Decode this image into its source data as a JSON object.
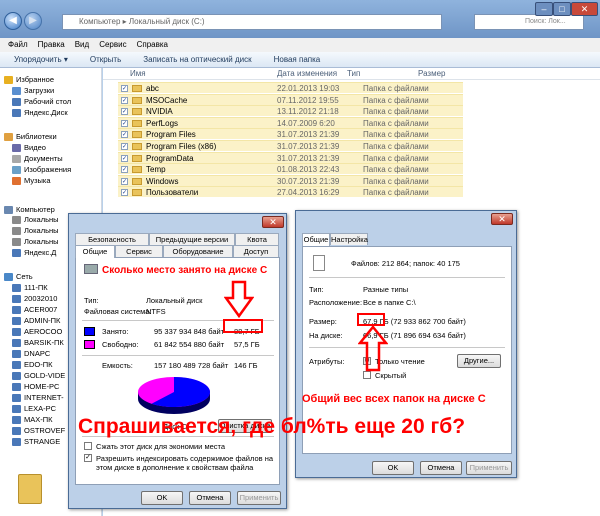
{
  "explorer": {
    "address": "Компьютер ▸ Локальный диск (C:)",
    "search_placeholder": "Поиск: Лок...",
    "menu": [
      "Файл",
      "Правка",
      "Вид",
      "Сервис",
      "Справка"
    ],
    "toolbar": [
      "Упорядочить ▾",
      "Открыть",
      "Записать на оптический диск",
      "Новая папка"
    ],
    "columns": {
      "name": "Имя",
      "date": "Дата изменения",
      "type": "Тип",
      "size": "Размер"
    },
    "nav": [
      {
        "label": "Избранное",
        "color": "#e8b020"
      },
      {
        "label": "Загрузки",
        "color": "#5a8fd0"
      },
      {
        "label": "Рабочий стол",
        "color": "#4a78b8"
      },
      {
        "label": "Яндекс.Диск",
        "color": "#4a78b8"
      },
      {
        "label": "Библиотеки",
        "color": "#e0a040"
      },
      {
        "label": "Видео",
        "color": "#6a6aa8"
      },
      {
        "label": "Документы",
        "color": "#a8a8a8"
      },
      {
        "label": "Изображения",
        "color": "#6aa0c8"
      },
      {
        "label": "Музыка",
        "color": "#e07030"
      },
      {
        "label": "Компьютер",
        "color": "#6a88b0"
      },
      {
        "label": "Локальны",
        "color": "#8a8a8a"
      },
      {
        "label": "Локальны",
        "color": "#8a8a8a"
      },
      {
        "label": "Локальны",
        "color": "#8a8a8a"
      },
      {
        "label": "Яндекс.Д",
        "color": "#4a78b8"
      },
      {
        "label": "Сеть",
        "color": "#4a88c8"
      },
      {
        "label": "111-ПК",
        "color": "#4a78b8"
      },
      {
        "label": "20032010",
        "color": "#4a78b8"
      },
      {
        "label": "ACER007",
        "color": "#4a78b8"
      },
      {
        "label": "ADMIN-ПК",
        "color": "#4a78b8"
      },
      {
        "label": "AEROCOO",
        "color": "#4a78b8"
      },
      {
        "label": "BARSIK-ПК",
        "color": "#4a78b8"
      },
      {
        "label": "DNAPC",
        "color": "#4a78b8"
      },
      {
        "label": "EDO-ПК",
        "color": "#4a78b8"
      },
      {
        "label": "GOLD-VIDE",
        "color": "#4a78b8"
      },
      {
        "label": "HOME-PC",
        "color": "#4a78b8"
      },
      {
        "label": "INTERNET-",
        "color": "#4a78b8"
      },
      {
        "label": "LEXA-PC",
        "color": "#4a78b8"
      },
      {
        "label": "MAX-ПК",
        "color": "#4a78b8"
      },
      {
        "label": "OSTROVEF",
        "color": "#4a78b8"
      },
      {
        "label": "STRANGE",
        "color": "#4a78b8"
      }
    ],
    "files": [
      {
        "name": "abc",
        "date": "22.01.2013 19:03",
        "type": "Папка с файлами"
      },
      {
        "name": "MSOCache",
        "date": "07.11.2012 19:55",
        "type": "Папка с файлами"
      },
      {
        "name": "NVIDIA",
        "date": "13.11.2012 21:18",
        "type": "Папка с файлами"
      },
      {
        "name": "PerfLogs",
        "date": "14.07.2009 6:20",
        "type": "Папка с файлами"
      },
      {
        "name": "Program Files",
        "date": "31.07.2013 21:39",
        "type": "Папка с файлами"
      },
      {
        "name": "Program Files (x86)",
        "date": "31.07.2013 21:39",
        "type": "Папка с файлами"
      },
      {
        "name": "ProgramData",
        "date": "31.07.2013 21:39",
        "type": "Папка с файлами"
      },
      {
        "name": "Temp",
        "date": "01.08.2013 22:43",
        "type": "Папка с файлами"
      },
      {
        "name": "Windows",
        "date": "30.07.2013 21:39",
        "type": "Папка с файлами"
      },
      {
        "name": "Пользователи",
        "date": "27.04.2013 16:29",
        "type": "Папка с файлами"
      }
    ]
  },
  "disk_dialog": {
    "tabs_row1": [
      "Безопасность",
      "Предыдущие версии",
      "Квота"
    ],
    "tabs_row2": [
      "Общие",
      "Сервис",
      "Оборудование",
      "Доступ"
    ],
    "drive_name": "",
    "type_label": "Тип:",
    "type_value": "Локальный диск",
    "fs_label": "Файловая система:",
    "fs_value": "NTFS",
    "used_label": "Занято:",
    "used_bytes": "95 337 934 848 байт",
    "used_gb": "88,7 ГБ",
    "free_label": "Свободно:",
    "free_bytes": "61 842 554 880 байт",
    "free_gb": "57,5 ГБ",
    "capacity_label": "Емкость:",
    "capacity_bytes": "157 180 489 728 байт",
    "capacity_gb": "146 ГБ",
    "disk_caption": "Диск C:",
    "cleanup_button": "Очистка диска",
    "compress_label": "Сжать этот диск для экономии места",
    "index_label": "Разрешить индексировать содержимое файлов на этом диске в дополнение к свойствам файла",
    "ok": "OK",
    "cancel": "Отмена",
    "apply": "Применить",
    "used_color": "#0000ff",
    "free_color": "#ff00ff",
    "used_fraction": 0.607
  },
  "folder_dialog": {
    "tabs": [
      "Общие",
      "Настройка"
    ],
    "files_summary": "Файлов: 212 864; папок: 40 175",
    "type_label": "Тип:",
    "type_value": "Разные типы",
    "location_label": "Расположение:",
    "location_value": "Все в папке C:\\",
    "size_label": "Размер:",
    "size_value": "67,9 ГБ (72 933 862 700 байт)",
    "ondisk_label": "На диске:",
    "ondisk_value": "66,9 ГБ (71 896 694 634 байт)",
    "attr_label": "Атрибуты:",
    "readonly_label": "Только чтение",
    "hidden_label": "Скрытый",
    "other_button": "Другие...",
    "ok": "OK",
    "cancel": "Отмена",
    "apply": "Применить"
  },
  "annotations": {
    "disk_note": "Сколько место занято на диске С",
    "folders_note": "Общий вес всех папок на диске С",
    "question": "Спрашивается, где бл%ть еще 20 гб?"
  }
}
